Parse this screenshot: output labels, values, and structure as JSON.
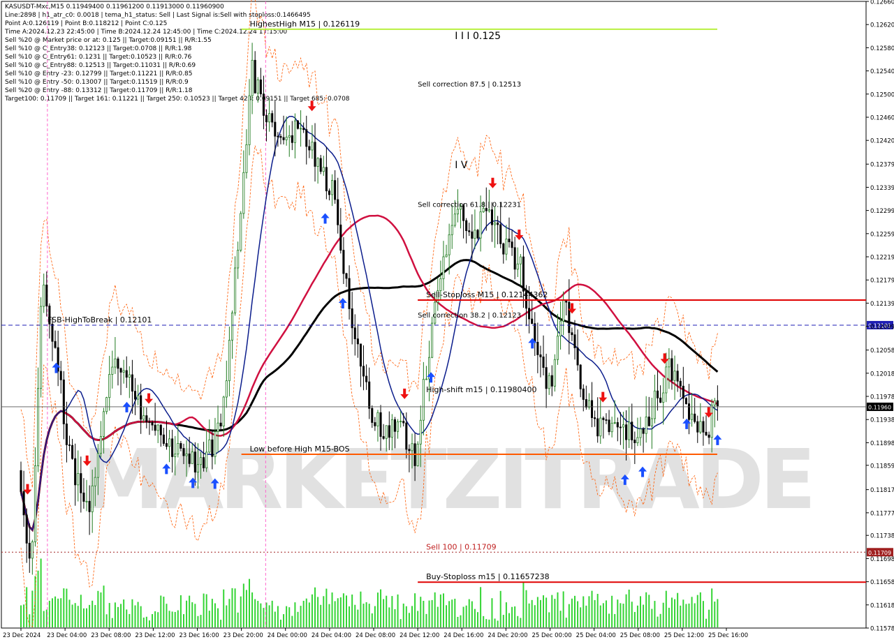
{
  "header": {
    "lines": [
      "KASUSDT-Mxc,M15  0.11949400 0.11961200 0.11913000 0.11960900",
      "Line:2898 | h1_atr_c0: 0.0018 | tema_h1_status: Sell | Last Signal is:Sell with stoploss:0.1466495",
      "Point A:0.126119 | Point B:0.118212 | Point C:0.125",
      "Time A:2024.12.23 22:45:00 | Time B:2024.12.24 12:45:00 | Time C:2024.12.24 17:15:00",
      "Sell %20 @ Market price or at: 0.125 || Target:0.09151 || R/R:1.55",
      "Sell %10 @ C_Entry38: 0.12123 || Target:0.0708 || R/R:1.98",
      "Sell %10 @ C_Entry61: 0.1231 || Target:0.10523 || R/R:0.76",
      "Sell %10 @ C_Entry88: 0.12513 || Target:0.11031 || R/R:0.69",
      "Sell %10 @ Entry -23: 0.12799 || Target:0.11221 || R/R:0.85",
      "Sell %10 @ Entry -50: 0.13007 || Target:0.11519 || R/R:0.9",
      "Sell %20 @ Entry -88: 0.13312 || Target:0.11709 || R/R:1.18",
      "Target100: 0.11709 || Target 161: 0.11221 || Target 250: 0.10523 || Target 423: 0.09151 || Target 685: 0.0708"
    ]
  },
  "watermark": "MARKETZITRADE",
  "colors": {
    "background": "#ffffff",
    "bull": "#1f7a1f",
    "bear": "#000000",
    "ma_blue": "#0b1d8c",
    "ma_red": "#d01040",
    "ma_black": "#000000",
    "red_line": "#e00000",
    "orange_line": "#ff5a00",
    "green_line": "#b8f040",
    "blue_dash": "#1e1eb4",
    "volume": "#33d433",
    "arrow_up": "#1a4fff",
    "arrow_down": "#ee1111"
  },
  "chart_data": {
    "type": "candlestick",
    "symbol": "KASUSDT-Mxc",
    "timeframe": "M15",
    "ylim": [
      0.11578,
      0.1266
    ],
    "y_ticks": [
      "0.12660",
      "0.12620",
      "0.12580",
      "0.12540",
      "0.12500",
      "0.12460",
      "0.12420",
      "0.12379",
      "0.12339",
      "0.12299",
      "0.12259",
      "0.12219",
      "0.12179",
      "0.12139",
      "0.12099",
      "0.12058",
      "0.12018",
      "0.11978",
      "0.11938",
      "0.11898",
      "0.11859",
      "0.11817",
      "0.11777",
      "0.11738",
      "0.11698",
      "0.11658",
      "0.11618",
      "0.11578"
    ],
    "x_ticks": [
      "23 Dec 2024",
      "23 Dec 04:00",
      "23 Dec 08:00",
      "23 Dec 12:00",
      "23 Dec 16:00",
      "23 Dec 20:00",
      "24 Dec 00:00",
      "24 Dec 04:00",
      "24 Dec 08:00",
      "24 Dec 12:00",
      "24 Dec 16:00",
      "24 Dec 20:00",
      "25 Dec 00:00",
      "25 Dec 04:00",
      "25 Dec 08:00",
      "25 Dec 12:00",
      "25 Dec 16:00"
    ],
    "current_price": "0.11960",
    "levels": [
      {
        "label": "HighestHigh   M15 | 0.126119",
        "price": 0.126119,
        "kind": "green",
        "start_time": "23 Dec 20:00"
      },
      {
        "label": "Sell-Stoploss M15 | 0.12144362",
        "price": 0.12144362,
        "kind": "red",
        "start_time": "24 Dec 12:00"
      },
      {
        "label": "FSB-HighToBreak | 0.12101",
        "price": 0.12101,
        "kind": "blue_dash",
        "axis_label": "0.12101",
        "start_time": "23 Dec 2024"
      },
      {
        "label": "High-shift m15 | 0.11980400",
        "price": 0.119804,
        "kind": "text",
        "start_time": "24 Dec 12:00"
      },
      {
        "label": "Low before High   M15-BOS",
        "price": 0.11878,
        "kind": "orange",
        "start_time": "23 Dec 20:00"
      },
      {
        "label": "Sell 100 | 0.11709",
        "price": 0.11709,
        "kind": "dotted",
        "axis_label": "0.11709",
        "start_time": "24 Dec 12:00"
      },
      {
        "label": "Buy-Stoploss m15 | 0.11657238",
        "price": 0.11657238,
        "kind": "red",
        "start_time": "24 Dec 12:00"
      }
    ],
    "annotations": [
      {
        "text": "I I I 0.125",
        "time": "24 Dec 16:00",
        "price": 0.12595
      },
      {
        "text": "Sell correction 87.5 | 0.12513",
        "time": "24 Dec 12:00",
        "price": 0.12513
      },
      {
        "text": "I V",
        "time": "24 Dec 16:00",
        "price": 0.12372
      },
      {
        "text": "Sell correction 61.8 | 0.12231",
        "time": "24 Dec 12:00",
        "price": 0.12305
      },
      {
        "text": "Sell correction 38.2 | 0.12123",
        "time": "24 Dec 12:00",
        "price": 0.12114
      }
    ],
    "series": [
      {
        "name": "",
        "type": "candlestick"
      },
      {
        "name": "",
        "type": "line",
        "color": "blue"
      },
      {
        "name": "",
        "type": "line",
        "color": "red"
      },
      {
        "name": "",
        "type": "line",
        "color": "black"
      },
      {
        "name": "",
        "type": "volume"
      }
    ]
  }
}
